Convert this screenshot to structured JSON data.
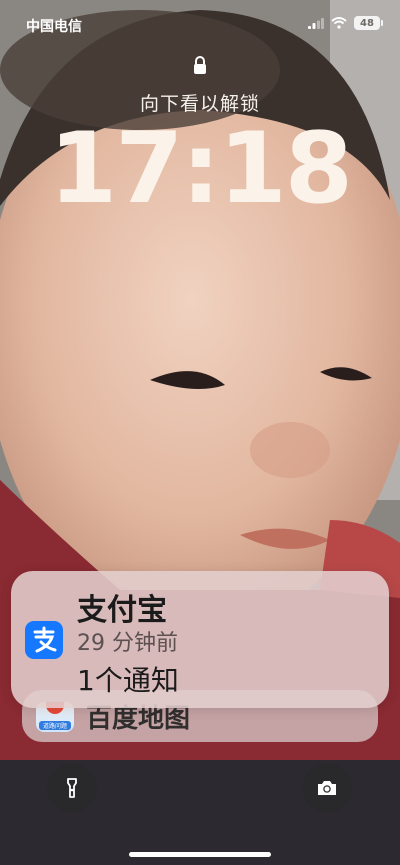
{
  "status_bar": {
    "carrier": "中国电信",
    "battery_level": "48"
  },
  "lock_screen": {
    "hint": "向下看以解锁",
    "time": "17:18"
  },
  "notification": {
    "app_name": "支付宝",
    "time_ago": "29 分钟前",
    "body": "1个通知",
    "icon": "alipay-icon"
  },
  "stacked_notification": {
    "app_name": "百度地图",
    "icon": "baidu-maps-icon",
    "icon_caption": "道路问题"
  },
  "quick_actions": {
    "left_icon": "flashlight-icon",
    "right_icon": "camera-icon"
  }
}
